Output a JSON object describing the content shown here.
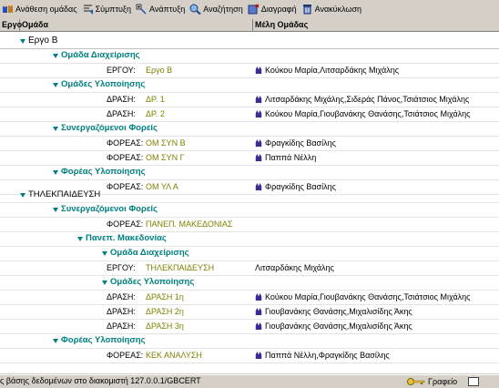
{
  "toolbar": {
    "items": [
      {
        "label": "Ανάθεση ομάδας",
        "icon": "assign-group-icon"
      },
      {
        "label": "Σύμπτυξη",
        "icon": "collapse-icon"
      },
      {
        "label": "Ανάπτυξη",
        "icon": "expand-icon"
      },
      {
        "label": "Αναζήτηση",
        "icon": "search-icon"
      },
      {
        "label": "Διαγραφή",
        "icon": "delete-icon"
      },
      {
        "label": "Ανακύκλωση",
        "icon": "recycle-icon"
      }
    ]
  },
  "columns": {
    "project": "Εργο",
    "group": "Ομάδα",
    "members": "Μέλη Ομάδας"
  },
  "tree": {
    "p1": {
      "name": "Εργο Β"
    },
    "p1_g1": {
      "name": "Ομάδα Διαχείρισης"
    },
    "p1_r1": {
      "label": "ΕΡΓΟΥ:",
      "value": "Εργο Β",
      "members": "Κούκου Μαρία,Λιτσαρδάκης Μιχάλης"
    },
    "p1_g2": {
      "name": "Ομάδες Υλοποίησης"
    },
    "p1_r2": {
      "label": "ΔΡΑΣΗ:",
      "value": "ΔΡ. 1",
      "members": "Λιτσαρδάκης Μιχάλης,Σιδεράς Πάνος,Τσιάτσιος Μιχάλης"
    },
    "p1_r3": {
      "label": "ΔΡΑΣΗ:",
      "value": "ΔΡ. 2",
      "members": "Κούκου Μαρία,Γιουβανάκης Θανάσης,Τσιάτσιος Μιχάλης"
    },
    "p1_g3": {
      "name": "Συνεργαζόμενοι Φορείς"
    },
    "p1_r4": {
      "label": "ΦΟΡΕΑΣ:",
      "value": "ΟΜ ΣΥΝ Β",
      "members": "Φραγκίδης Βασίλης"
    },
    "p1_r5": {
      "label": "ΦΟΡΕΑΣ:",
      "value": "ΟΜ ΣΥΝ Γ",
      "members": "Παππά Νέλλη"
    },
    "p1_g4": {
      "name": "Φορέας Υλοποίησης"
    },
    "p1_r6": {
      "label": "ΦΟΡΕΑΣ:",
      "value": "ΟΜ ΥΛ Α",
      "members": "Φραγκίδης Βασίλης"
    },
    "p2": {
      "name": "ΤΗΛΕΚΠΑΙΔΕΥΣΗ"
    },
    "p2_g1": {
      "name": "Συνεργαζόμενοι Φορείς"
    },
    "p2_r1": {
      "label": "ΦΟΡΕΑΣ:",
      "value": "ΠΑΝΕΠ. ΜΑΚΕΔΟΝΙΑΣ",
      "members": ""
    },
    "p2_g2": {
      "name": "Πανεπ. Μακεδονίας"
    },
    "p2_g3": {
      "name": "Ομάδα Διαχείρισης"
    },
    "p2_r2": {
      "label": "ΕΡΓΟΥ:",
      "value": "ΤΗΛΕΚΠΑΙΔΕΥΣΗ",
      "members": "Λιτσαρδάκης Μιχάλης"
    },
    "p2_g4": {
      "name": "Ομάδες Υλοποίησης"
    },
    "p2_r3": {
      "label": "ΔΡΑΣΗ:",
      "value": "ΔΡΑΣΗ 1η",
      "members": "Κούκου Μαρία,Γιουβανάκης Θανάσης,Τσιάτσιος Μιχάλης"
    },
    "p2_r4": {
      "label": "ΔΡΑΣΗ:",
      "value": "ΔΡΑΣΗ 2η",
      "members": "Γιουβανάκης Θανάσης,Μιχαλισίδης Άκης"
    },
    "p2_r5": {
      "label": "ΔΡΑΣΗ:",
      "value": "ΔΡΑΣΗ 3η",
      "members": "Γιουβανάκης Θανάσης,Μιχαλισίδης Άκης"
    },
    "p2_g5": {
      "name": "Φορέας Υλοποίησης"
    },
    "p2_r6": {
      "label": "ΦΟΡΕΑΣ:",
      "value": "ΚΕΚ ΑΝΑΛΥΣΗ",
      "members": "Παππά Νέλλη,Φραγκίδης Βασίλης"
    }
  },
  "status": {
    "text": "ς βάσης δεδομένων στο διακομιστή 127.0.0.1/GBCERT",
    "mode": "Γραφείο"
  },
  "colors": {
    "group_teal": "#008080",
    "value_olive": "#808000",
    "member_icon": "#3a2a9a"
  }
}
